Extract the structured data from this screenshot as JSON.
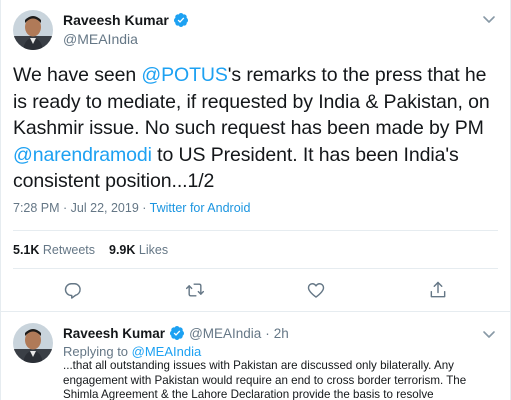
{
  "main_tweet": {
    "display_name": "Raveesh Kumar",
    "handle": "@MEAIndia",
    "text": {
      "p1": "We have seen ",
      "mention_potus": "@POTUS",
      "p2": "'s remarks to the press that he is ready to mediate, if requested by India & Pakistan, on Kashmir issue. No such request has been made by PM ",
      "mention_modi": "@narendramodi",
      "p3": " to US President. It has been India's consistent position...1/2"
    },
    "timestamp": "7:28 PM · Jul 22, 2019 · ",
    "source": "Twitter for Android",
    "retweets_count": "5.1K",
    "retweets_label": "Retweets",
    "likes_count": "9.9K",
    "likes_label": "Likes",
    "icons": [
      "reply-icon",
      "retweet-icon",
      "like-icon",
      "share-icon"
    ]
  },
  "reply_tweet": {
    "display_name": "Raveesh Kumar",
    "handle": "@MEAIndia",
    "separator": "·",
    "time": "2h",
    "replying_prefix": "Replying to ",
    "replying_to": "@MEAIndia",
    "text": "...that all outstanding issues with Pakistan are discussed only bilaterally. Any engagement with Pakistan would require an end to cross border terrorism. The Shimla Agreement & the Lahore Declaration provide the basis to resolve"
  },
  "colors": {
    "accent": "#1da1f2",
    "verified": "#1da1f2",
    "secondary_text": "#657786",
    "divider": "#e6ecf0"
  }
}
